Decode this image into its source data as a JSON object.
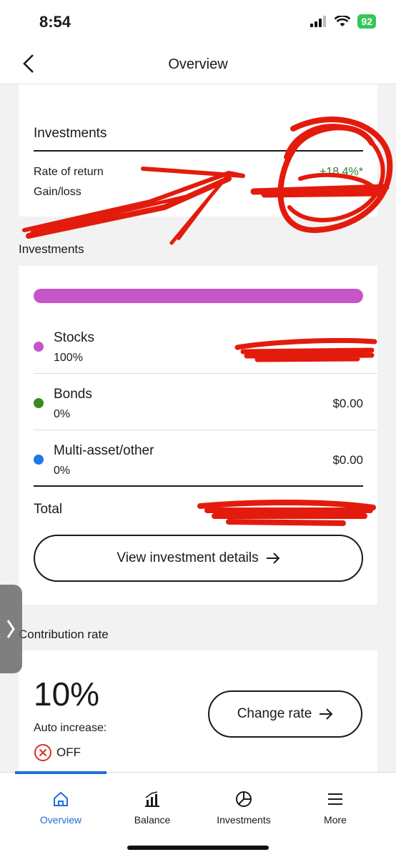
{
  "status_bar": {
    "time": "8:54",
    "battery": "92"
  },
  "header": {
    "title": "Overview"
  },
  "summary_card": {
    "heading": "Investments",
    "rate_of_return_label": "Rate of return",
    "rate_of_return_value": "+18.4%*",
    "gain_loss_label": "Gain/loss"
  },
  "investments_section": {
    "label": "Investments",
    "allocation_color": "#c555c9",
    "assets": [
      {
        "name": "Stocks",
        "percent": "100%",
        "amount": "",
        "color": "#c555c9"
      },
      {
        "name": "Bonds",
        "percent": "0%",
        "amount": "$0.00",
        "color": "#3c8a1f"
      },
      {
        "name": "Multi-asset/other",
        "percent": "0%",
        "amount": "$0.00",
        "color": "#1e7ae6"
      }
    ],
    "total_label": "Total",
    "details_button": "View investment details"
  },
  "contribution_section": {
    "label": "Contribution rate",
    "rate": "10%",
    "auto_increase_label": "Auto increase:",
    "auto_increase_value": "OFF",
    "change_button": "Change rate"
  },
  "tabs": [
    {
      "label": "Overview",
      "icon": "home-icon",
      "active": true
    },
    {
      "label": "Balance",
      "icon": "bar-chart-icon",
      "active": false
    },
    {
      "label": "Investments",
      "icon": "pie-chart-icon",
      "active": false
    },
    {
      "label": "More",
      "icon": "menu-icon",
      "active": false
    }
  ],
  "colors": {
    "accent": "#1e6fd9",
    "gain": "#2e7d32",
    "redaction": "#e31b0c"
  }
}
